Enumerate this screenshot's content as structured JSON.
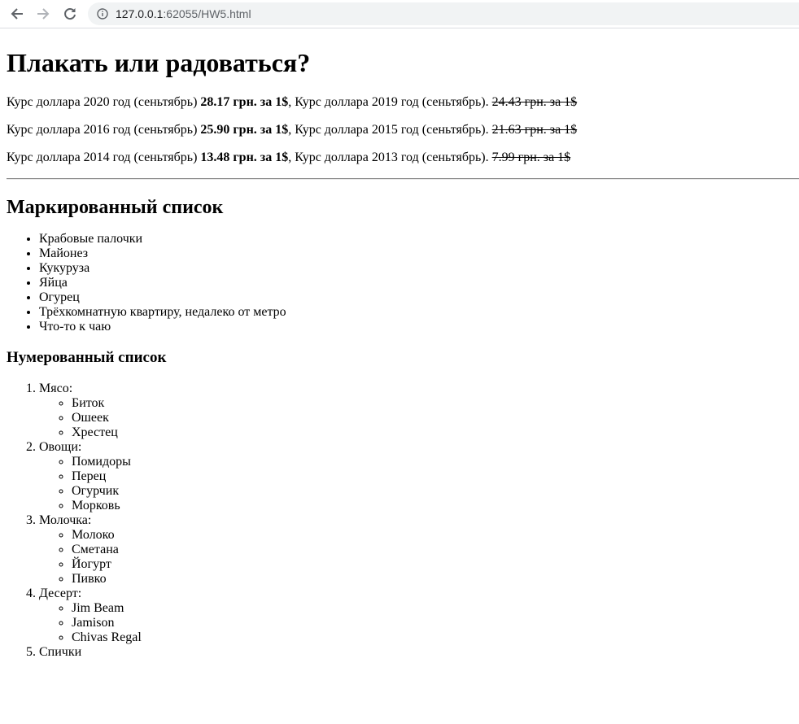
{
  "browser": {
    "url_host": "127.0.0.1",
    "url_rest": ":62055/HW5.html"
  },
  "page": {
    "title": "Плакать или радоваться?",
    "rates": [
      {
        "pre": "Курс доллара 2020 год (сеньтябрь) ",
        "bold": "28.17 грн. за 1$",
        "mid": ", Курс доллара 2019 год (сеньтябрь). ",
        "struck": "24.43 грн. за 1$"
      },
      {
        "pre": "Курс доллара 2016 год (сеньтябрь) ",
        "bold": "25.90 грн. за 1$",
        "mid": ", Курс доллара 2015 год (сеньтябрь). ",
        "struck": "21.63 грн. за 1$"
      },
      {
        "pre": "Курс доллара 2014 год (сеньтябрь) ",
        "bold": "13.48 грн. за 1$",
        "mid": ", Курс доллара 2013 год (сеньтябрь). ",
        "struck": "7.99 грн. за 1$"
      }
    ],
    "bulleted_heading": "Маркированный список",
    "bulleted": [
      "Крабовые палочки",
      "Майонез",
      "Кукуруза",
      "Яйца",
      "Огурец",
      "Трёхкомнатную квартиру, недалеко от метро",
      "Что-то к чаю"
    ],
    "numbered_heading": "Нумерованный список",
    "numbered": [
      {
        "label": "Мясо:",
        "sub": [
          "Биток",
          "Ошеек",
          "Хрестец"
        ]
      },
      {
        "label": "Овощи:",
        "sub": [
          "Помидоры",
          "Перец",
          "Огурчик",
          "Морковь"
        ]
      },
      {
        "label": "Молочка:",
        "sub": [
          "Молоко",
          "Сметана",
          "Йогурт",
          "Пивко"
        ]
      },
      {
        "label": "Десерт:",
        "sub": [
          "Jim Beam",
          "Jamison",
          "Chivas Regal"
        ]
      },
      {
        "label": "Спички",
        "sub": []
      }
    ]
  }
}
